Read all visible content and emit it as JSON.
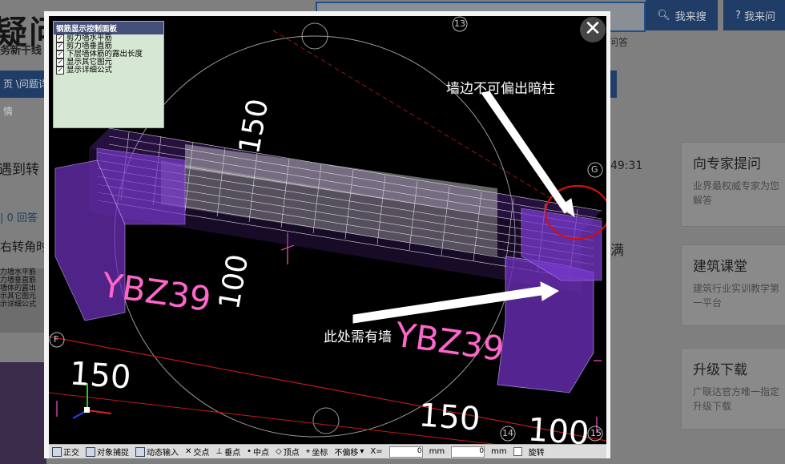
{
  "page": {
    "brand": "疑问",
    "brand_sub": "务新干线",
    "search_button": "我来搜",
    "ask_button": "我来问",
    "hot_text": "问答",
    "nav_text": "页 \\问题详情",
    "question_title": "遇到转",
    "question_meta": "| 0 回答",
    "question_body": "右转角时",
    "question_time": "49:31",
    "question_tail": "满",
    "thumb_lines": [
      "力墙水平筋",
      "力墙垂直筋",
      "墙体的露出",
      "示其它图元",
      "示详细公式"
    ],
    "side_cards": [
      {
        "title": "向专家提问",
        "desc": "业界最权威专家为您解答"
      },
      {
        "title": "建筑课堂",
        "desc": "建筑行业实训教学第一平台"
      },
      {
        "title": "升级下载",
        "desc": "广联达官方唯一指定升级下载"
      }
    ]
  },
  "lightbox": {
    "panel_title": "钢筋显示控制面板",
    "panel_items": [
      "剪力墙水平筋",
      "剪力墙垂直筋",
      "下层墙体筋的露出长度",
      "显示其它图元",
      "显示详细公式"
    ],
    "annotation_top": "墙边不可偏出暗柱",
    "annotation_bottom": "此处需有墙",
    "labels": {
      "ybz_left": "YBZ39",
      "ybz_right": "YBZ39",
      "dim_150_top": "150",
      "dim_100_left": "100",
      "dim_150_bl": "150",
      "dim_150_br": "150",
      "dim_100_br": "100",
      "grid_13": "13",
      "grid_g": "G",
      "grid_f": "F",
      "grid_14": "14",
      "grid_15": "15"
    },
    "status": {
      "ortho": "正交",
      "snap": "对象捕捉",
      "dynamic": "动态输入",
      "intersection": "交点",
      "perpendicular": "垂点",
      "midpoint": "中点",
      "vertex": "顶点",
      "coordinate": "坐标",
      "offset": "不偏移",
      "x_label": "X=",
      "x_value": "0",
      "y_value": "0",
      "unit": "mm",
      "rotate": "旋转"
    },
    "colors": {
      "purple": "#8a3cd6",
      "magenta": "#ff66cc",
      "annotation_circle": "#d01010"
    }
  }
}
